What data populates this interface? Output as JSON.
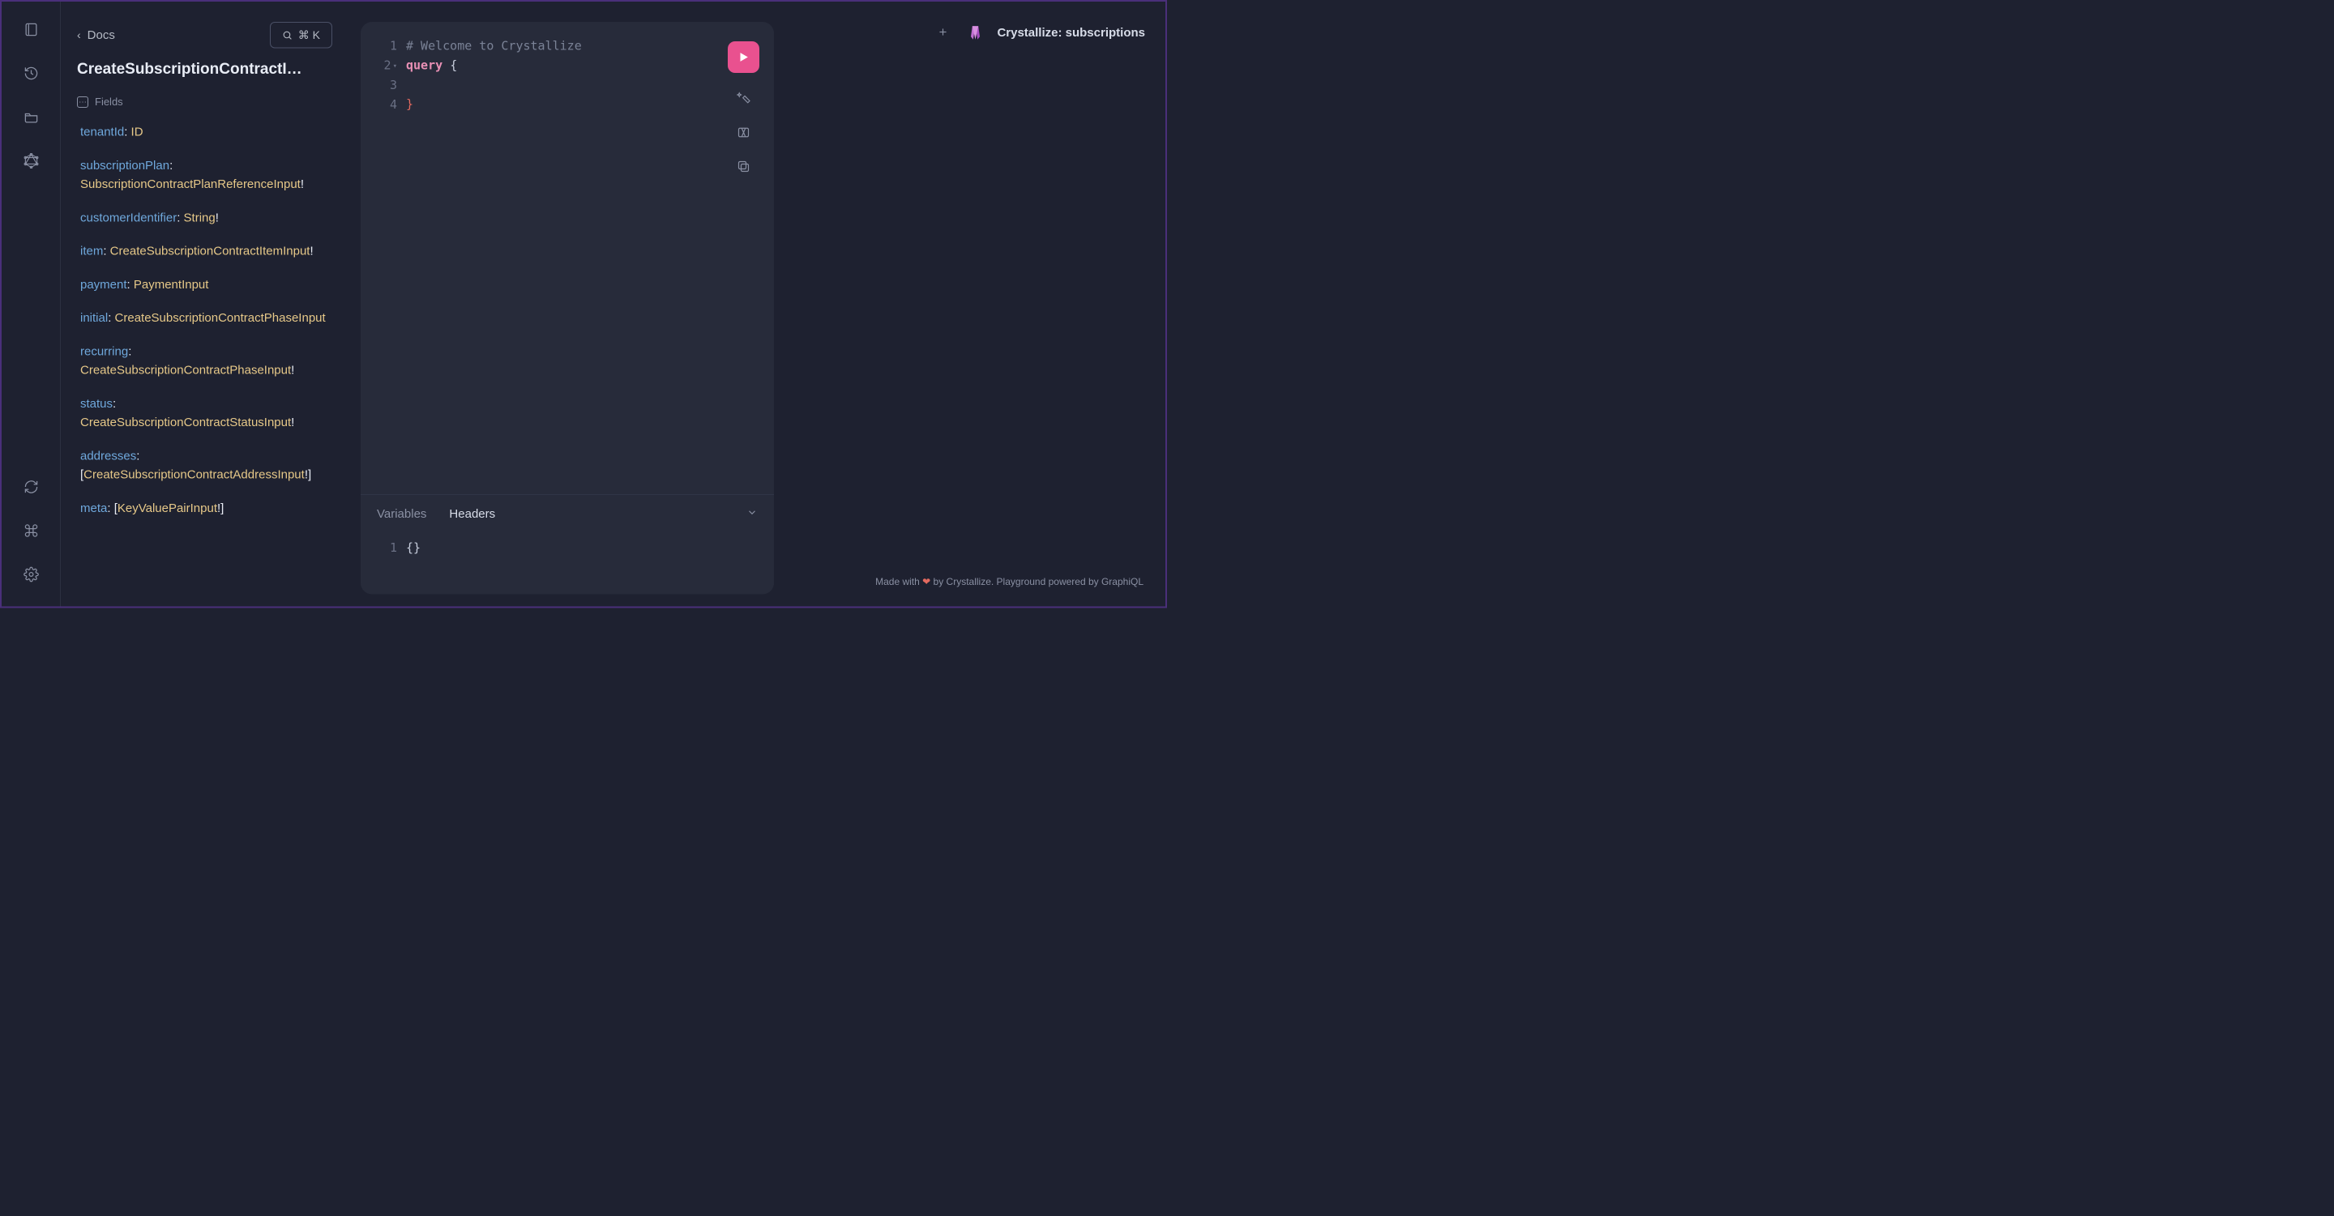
{
  "nav": {
    "top_icons": [
      "book-icon",
      "history-icon",
      "folder-icon",
      "graphql-icon"
    ],
    "bottom_icons": [
      "refresh-icon",
      "shortcuts-icon",
      "gear-icon"
    ]
  },
  "docs": {
    "back_label": "Docs",
    "search_shortcut": "⌘ K",
    "title": "CreateSubscriptionContractI…",
    "fields_label": "Fields",
    "fields": [
      {
        "name": "tenantId",
        "type": "ID",
        "nonnull": false,
        "list": false
      },
      {
        "name": "subscriptionPlan",
        "type": "SubscriptionContractPlanReferenceInput",
        "nonnull": true,
        "list": false
      },
      {
        "name": "customerIdentifier",
        "type": "String",
        "nonnull": true,
        "list": false
      },
      {
        "name": "item",
        "type": "CreateSubscriptionContractItemInput",
        "nonnull": true,
        "list": false
      },
      {
        "name": "payment",
        "type": "PaymentInput",
        "nonnull": false,
        "list": false
      },
      {
        "name": "initial",
        "type": "CreateSubscriptionContractPhaseInput",
        "nonnull": false,
        "list": false
      },
      {
        "name": "recurring",
        "type": "CreateSubscriptionContractPhaseInput",
        "nonnull": true,
        "list": false
      },
      {
        "name": "status",
        "type": "CreateSubscriptionContractStatusInput",
        "nonnull": true,
        "list": false
      },
      {
        "name": "addresses",
        "type": "CreateSubscriptionContractAddressInput",
        "nonnull": true,
        "list": true
      },
      {
        "name": "meta",
        "type": "KeyValuePairInput",
        "nonnull": true,
        "list": true
      }
    ]
  },
  "editor": {
    "lines": {
      "l1_comment": "# Welcome to Crystallize",
      "l2_keyword": "query",
      "l2_brace": "{",
      "l4_brace": "}"
    },
    "gutter": [
      "1",
      "2",
      "3",
      "4"
    ]
  },
  "bottom": {
    "tabs": {
      "variables": "Variables",
      "headers": "Headers"
    },
    "headers_gutter": "1",
    "headers_value": "{}"
  },
  "results": {
    "title": "Crystallize: subscriptions"
  },
  "footer": {
    "pre": "Made with ",
    "heart": "❤",
    "post": " by Crystallize. Playground powered by GraphiQL"
  }
}
